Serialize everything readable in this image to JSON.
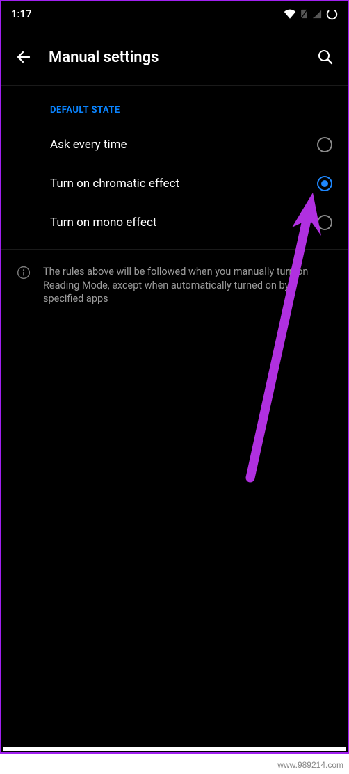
{
  "status": {
    "time": "1:17"
  },
  "header": {
    "title": "Manual settings"
  },
  "section": {
    "title": "DEFAULT STATE",
    "options": [
      {
        "label": "Ask every time",
        "selected": false
      },
      {
        "label": "Turn on chromatic effect",
        "selected": true
      },
      {
        "label": "Turn on mono effect",
        "selected": false
      }
    ]
  },
  "info": {
    "text": "The rules above will be followed when you manually turn on Reading Mode, except when automatically turned on by specified apps"
  },
  "watermark": "www.989214.com"
}
